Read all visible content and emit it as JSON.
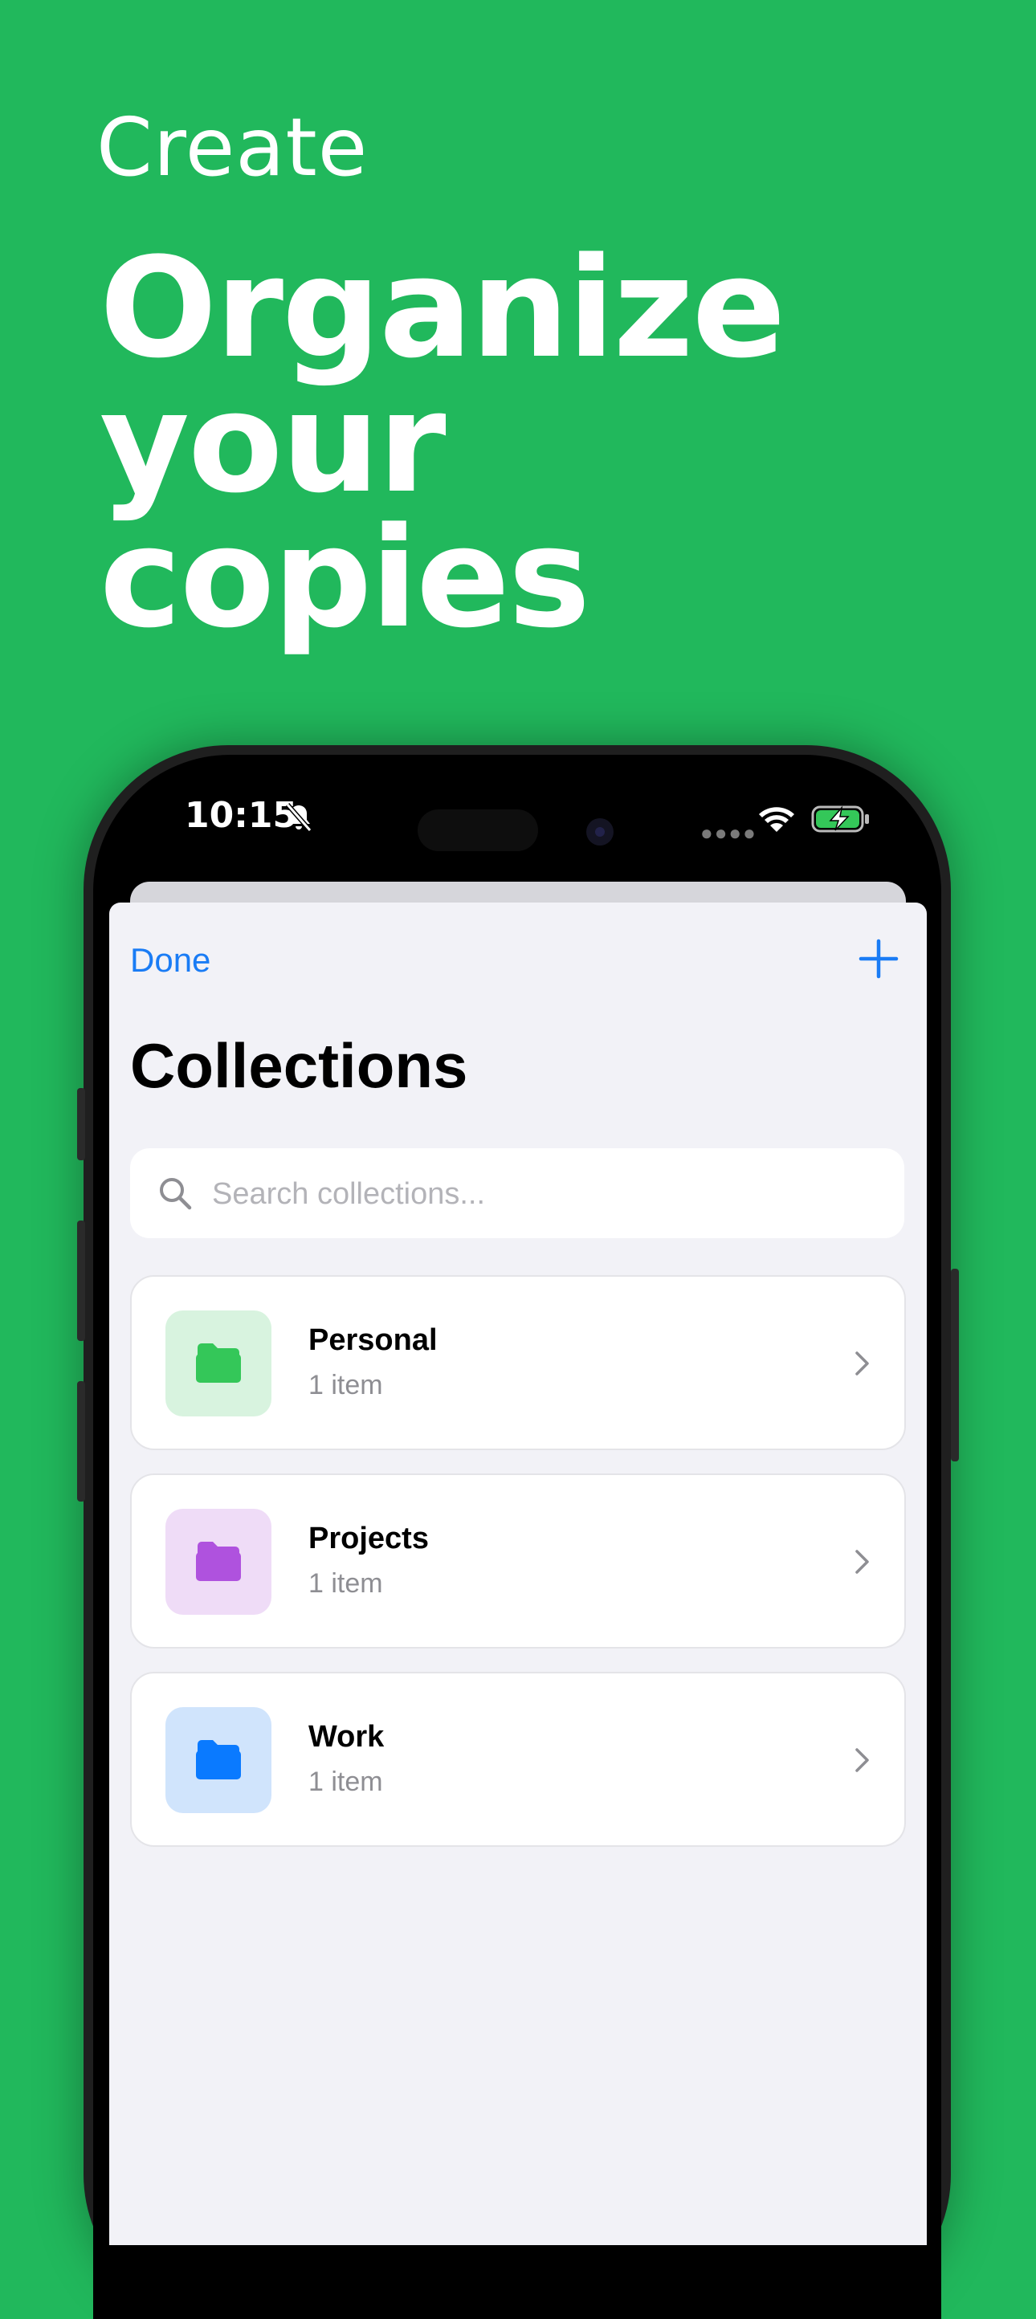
{
  "hero": {
    "eyebrow": "Create",
    "title_lines": [
      "Organize",
      "your",
      "copies"
    ]
  },
  "status_bar": {
    "time": "10:15",
    "icons": [
      "bell-slash-icon",
      "signal-dots-icon",
      "wifi-icon",
      "battery-charging-icon"
    ]
  },
  "nav": {
    "done_label": "Done",
    "add_icon": "plus-icon"
  },
  "page": {
    "title": "Collections"
  },
  "search": {
    "placeholder": "Search collections...",
    "value": ""
  },
  "collections": [
    {
      "name": "Personal",
      "count": "1 item",
      "icon": "folder-icon",
      "color": "#34c759",
      "bg": "#d8f3df"
    },
    {
      "name": "Projects",
      "count": "1 item",
      "icon": "folder-icon",
      "color": "#af52de",
      "bg": "#efdcf7"
    },
    {
      "name": "Work",
      "count": "1 item",
      "icon": "folder-icon",
      "color": "#0a7aff",
      "bg": "#d0e4fc"
    }
  ],
  "colors": {
    "background": "#21b85c",
    "accent": "#1a7cf5"
  }
}
